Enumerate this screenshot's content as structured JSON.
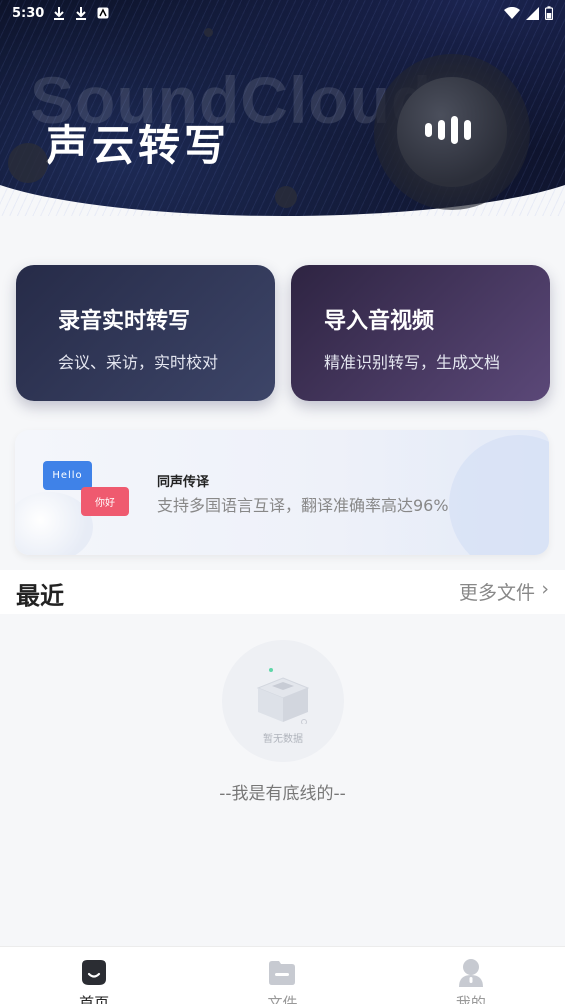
{
  "status_bar": {
    "time": "5:30"
  },
  "hero": {
    "watermark": "SoundCloud",
    "title": "声云转写"
  },
  "cards": {
    "record": {
      "title": "录音实时转写",
      "subtitle": "会议、采访，实时校对"
    },
    "import": {
      "title": "导入音视频",
      "subtitle": "精准识别转写，生成文档"
    }
  },
  "translation": {
    "bubble_en": "Hello",
    "bubble_cn": "你好",
    "title": "同声传译",
    "subtitle": "支持多国语言互译，翻译准确率高达96%"
  },
  "recent": {
    "title": "最近",
    "more_label": "更多文件",
    "empty_label": "暂无数据",
    "bottom_line": "--我是有底线的--"
  },
  "nav": {
    "items": [
      {
        "label": "首页",
        "icon": "home-icon",
        "active": true
      },
      {
        "label": "文件",
        "icon": "folder-icon",
        "active": false
      },
      {
        "label": "我的",
        "icon": "user-icon",
        "active": false
      }
    ]
  },
  "colors": {
    "accent_blue": "#3f82e8",
    "accent_red": "#ef5a6f",
    "card_left": "#262b48",
    "card_right": "#5b4878"
  }
}
